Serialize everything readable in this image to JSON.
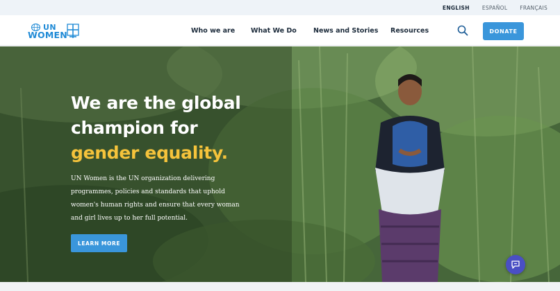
{
  "languages": [
    {
      "label": "ENGLISH",
      "active": true
    },
    {
      "label": "ESPAÑOL",
      "active": false
    },
    {
      "label": "FRANÇAIS",
      "active": false
    }
  ],
  "logo": {
    "line1": "UN",
    "line2": "WOMEN"
  },
  "nav": {
    "items": [
      "Who we are",
      "What We Do",
      "News and Stories",
      "Resources"
    ],
    "donate_label": "DONATE"
  },
  "hero": {
    "title_line1": "We are the global",
    "title_line2": "champion for",
    "title_accent": "gender equality.",
    "description": "UN Women is the UN organization delivering programmes, policies and standards that uphold women's human rights and ensure that every woman and girl lives up to her full potential.",
    "cta_label": "LEARN MORE"
  },
  "icons": {
    "search": "search-icon",
    "chat": "chat-icon",
    "logo_globe": "un-emblem-icon",
    "logo_mark": "women-symbol-icon"
  },
  "colors": {
    "accent_blue": "#3a96db",
    "title_yellow": "#f5c33b",
    "logo_blue": "#1f8ad6",
    "chat_purple": "#4a4fc4"
  }
}
